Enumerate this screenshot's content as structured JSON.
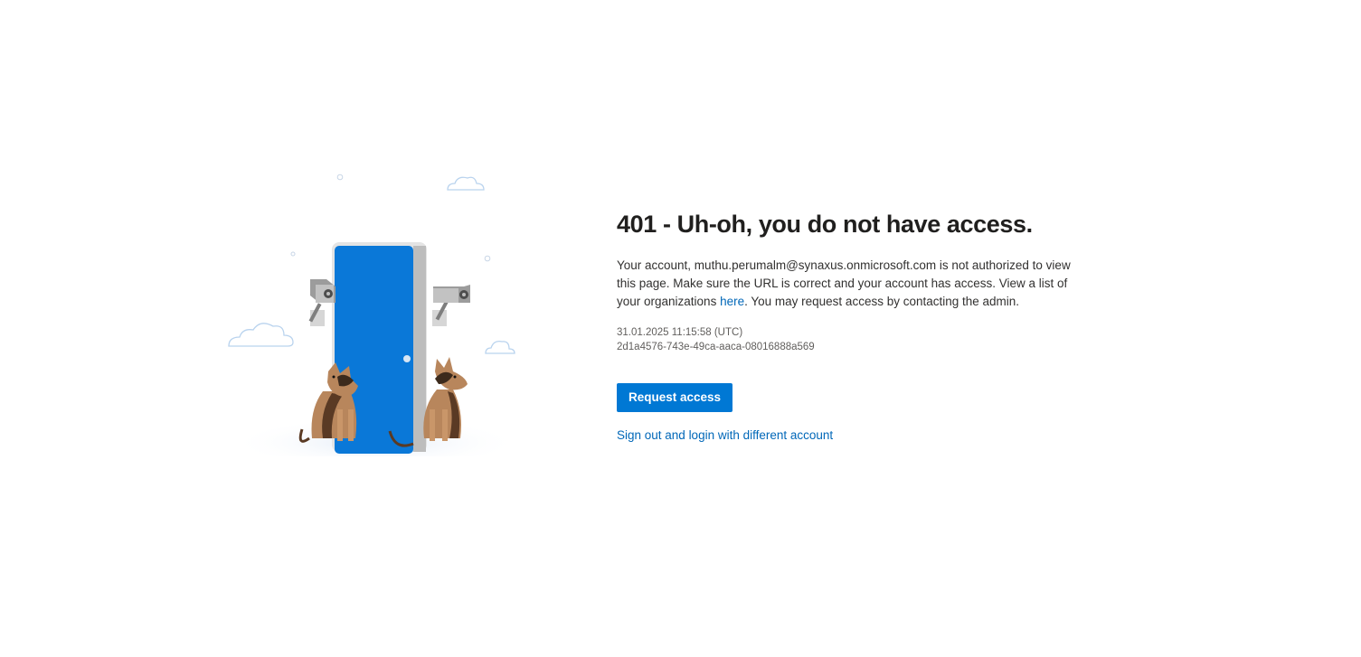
{
  "error": {
    "title": "401 - Uh-oh, you do not have access.",
    "message_part1": "Your account, muthu.perumalm@synaxus.onmicrosoft.com is not authorized to view this page. Make sure the URL is correct and your account has access. View a list of your organizations ",
    "here_link": "here",
    "message_part2": ". You may request access by contacting the admin.",
    "timestamp": "31.01.2025 11:15:58 (UTC)",
    "activity_id": "2d1a4576-743e-49ca-aaca-08016888a569"
  },
  "actions": {
    "request_access_label": "Request access",
    "sign_out_label": "Sign out and login with different account"
  },
  "colors": {
    "accent": "#0078d4",
    "link": "#0067b8",
    "door": "#0a78d8"
  },
  "illustration": {
    "icons": [
      "door-illustration",
      "security-camera-icon",
      "guard-dog-icon",
      "cloud-icon"
    ]
  }
}
